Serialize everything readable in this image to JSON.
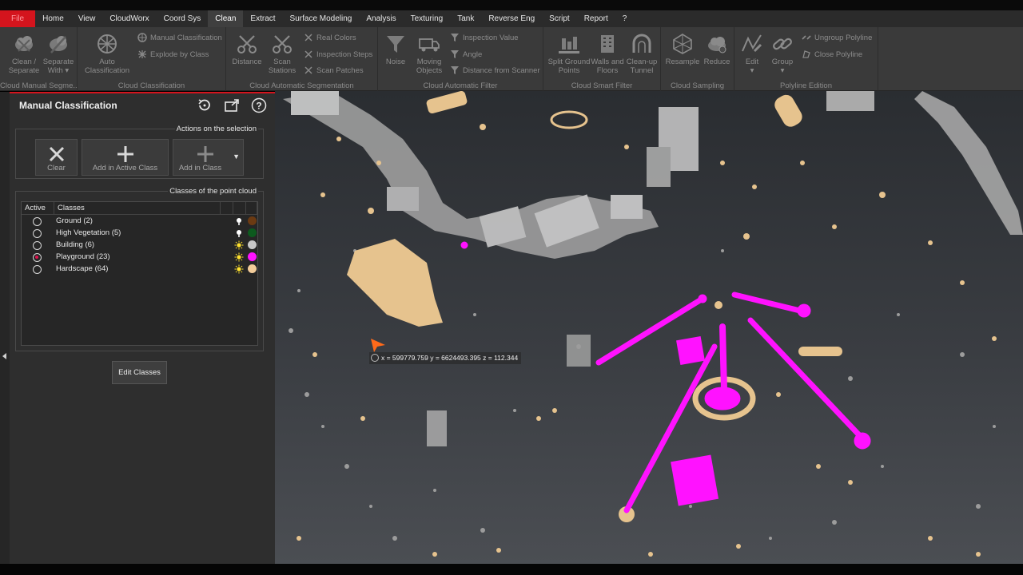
{
  "menu": {
    "items": [
      "File",
      "Home",
      "View",
      "CloudWorx",
      "Coord Sys",
      "Clean",
      "Extract",
      "Surface Modeling",
      "Analysis",
      "Texturing",
      "Tank",
      "Reverse Eng",
      "Script",
      "Report",
      "?"
    ],
    "active": "Clean"
  },
  "ribbon": {
    "groups": [
      {
        "label": "Cloud Manual Segme...",
        "buttons": [
          "Clean / Separate",
          "Separate With"
        ]
      },
      {
        "label": "Cloud Classification",
        "buttons": [
          "Auto Classification"
        ],
        "small": [
          "Manual Classification",
          "Explode by Class"
        ]
      },
      {
        "label": "Cloud Automatic Segmentation",
        "buttons": [
          "Distance",
          "Scan Stations"
        ],
        "small": [
          "Real Colors",
          "Inspection Steps",
          "Scan Patches"
        ]
      },
      {
        "label": "Cloud Automatic Filter",
        "buttons": [
          "Noise",
          "Moving Objects"
        ],
        "small": [
          "Inspection Value",
          "Angle",
          "Distance from Scanner"
        ]
      },
      {
        "label": "Cloud Smart Filter",
        "buttons": [
          "Split Ground Points",
          "Walls and Floors",
          "Clean-up Tunnel"
        ]
      },
      {
        "label": "Cloud Sampling",
        "buttons": [
          "Resample",
          "Reduce"
        ]
      },
      {
        "label": "Polyline Edition",
        "buttons": [
          "Edit",
          "Group"
        ],
        "small": [
          "Ungroup Polyline",
          "Close Polyline"
        ]
      }
    ],
    "labels": {
      "clean_separate_1": "Clean /",
      "clean_separate_2": "Separate",
      "separate_with_1": "Separate",
      "separate_with_2": "With",
      "auto_class_1": "Auto",
      "auto_class_2": "Classification",
      "distance": "Distance",
      "scan_stations_1": "Scan",
      "scan_stations_2": "Stations",
      "noise": "Noise",
      "moving_1": "Moving",
      "moving_2": "Objects",
      "split_1": "Split Ground",
      "split_2": "Points",
      "walls_1": "Walls and",
      "walls_2": "Floors",
      "tunnel_1": "Clean-up",
      "tunnel_2": "Tunnel",
      "resample": "Resample",
      "reduce": "Reduce",
      "edit": "Edit",
      "group": "Group"
    }
  },
  "panel": {
    "title": "Manual Classification",
    "actions_label": "Actions on the selection",
    "actions": {
      "clear": "Clear",
      "add_active": "Add in Active Class",
      "add_class": "Add in Class"
    },
    "classes_label": "Classes of the point cloud",
    "columns": {
      "active": "Active",
      "classes": "Classes"
    },
    "classes": [
      {
        "name": "Ground (2)",
        "active": false,
        "bulb": "white",
        "color": "#6b3a12"
      },
      {
        "name": "High  Vegetation (5)",
        "active": false,
        "bulb": "white",
        "color": "#0d5a1e"
      },
      {
        "name": "Building (6)",
        "active": false,
        "bulb": "yellow",
        "color": "#c8c8c8"
      },
      {
        "name": "Playground (23)",
        "active": true,
        "bulb": "yellow",
        "color": "#ff12ff"
      },
      {
        "name": "Hardscape (64)",
        "active": false,
        "bulb": "yellow",
        "color": "#f3cc9a"
      }
    ],
    "edit_classes": "Edit Classes"
  },
  "viewport": {
    "coordinate_readout": "x = 599779.759 y = 6624493.395 z = 112.344"
  },
  "colors": {
    "accent": "#d4141d",
    "playground": "#ff12ff",
    "hardscape": "#e8c594",
    "building": "#bdbdbd"
  }
}
